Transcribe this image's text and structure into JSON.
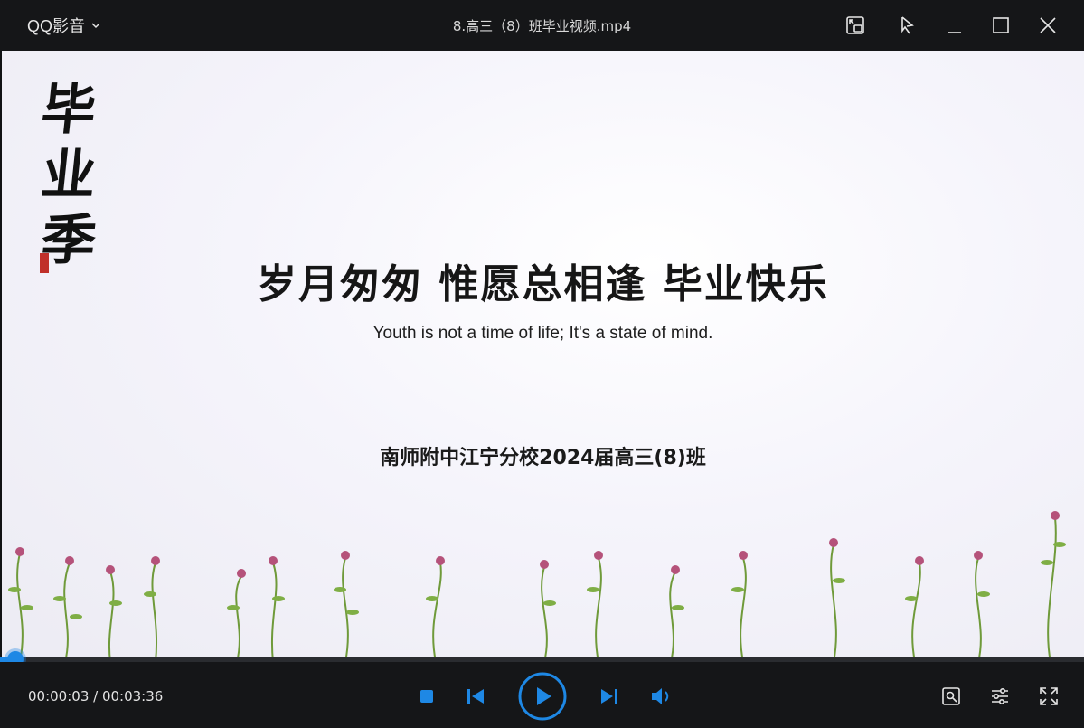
{
  "app": {
    "name": "QQ影音",
    "window_title": "8.高三（8）班毕业视频.mp4"
  },
  "video": {
    "brush_title": [
      "毕",
      "业",
      "季"
    ],
    "headline": "岁月匆匆 惟愿总相逢 毕业快乐",
    "subline": "Youth is not a time of life; It's a state of mind.",
    "school": "南师附中江宁分校2024届高三(8)班"
  },
  "playback": {
    "current_time": "00:00:03",
    "total_time": "00:03:36",
    "time_display": "00:00:03 / 00:03:36",
    "progress_fraction": 0.0139,
    "state": "paused"
  },
  "colors": {
    "accent": "#1e88e5",
    "titlebar_bg": "#151618",
    "controls_bg": "#151618",
    "seal_red": "#c0302a"
  },
  "icons": {
    "titlebar": [
      "chevron-down-icon",
      "picture-in-picture-icon",
      "pin-icon",
      "minimize-icon",
      "maximize-icon",
      "close-icon"
    ],
    "controls": [
      "stop-icon",
      "previous-icon",
      "play-icon",
      "next-icon",
      "volume-icon",
      "toolbox-icon",
      "settings-icon",
      "fullscreen-icon"
    ]
  }
}
